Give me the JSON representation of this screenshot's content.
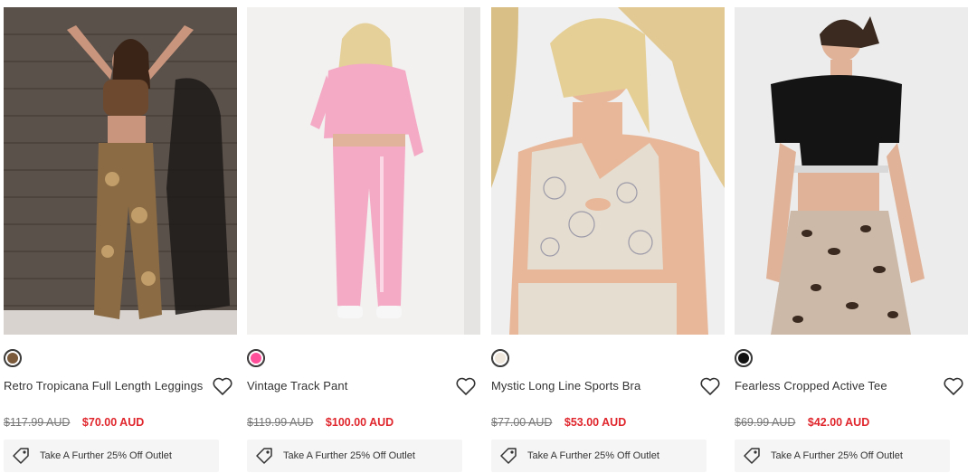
{
  "products": [
    {
      "name": "Retro Tropicana Full Length Leggings",
      "was_price": "$117.99 AUD",
      "now_price": "$70.00 AUD",
      "swatch_color": "#7a5a3a",
      "promo": "Take A Further 25% Off Outlet",
      "icons": {
        "heart": "heart-icon",
        "tag": "tag-icon"
      }
    },
    {
      "name": "Vintage Track Pant",
      "was_price": "$119.99 AUD",
      "now_price": "$100.00 AUD",
      "swatch_color": "#ff4f9a",
      "promo": "Take A Further 25% Off Outlet",
      "icons": {
        "heart": "heart-icon",
        "tag": "tag-icon"
      }
    },
    {
      "name": "Mystic Long Line Sports Bra",
      "was_price": "$77.00 AUD",
      "now_price": "$53.00 AUD",
      "swatch_color": "#efe7dc",
      "promo": "Take A Further 25% Off Outlet",
      "icons": {
        "heart": "heart-icon",
        "tag": "tag-icon"
      }
    },
    {
      "name": "Fearless Cropped Active Tee",
      "was_price": "$69.99 AUD",
      "now_price": "$42.00 AUD",
      "swatch_color": "#111111",
      "promo": "Take A Further 25% Off Outlet",
      "icons": {
        "heart": "heart-icon",
        "tag": "tag-icon"
      }
    }
  ],
  "colors": {
    "sale_price": "#e0262d",
    "was_price": "#777777",
    "promo_bg": "#f5f5f5"
  }
}
